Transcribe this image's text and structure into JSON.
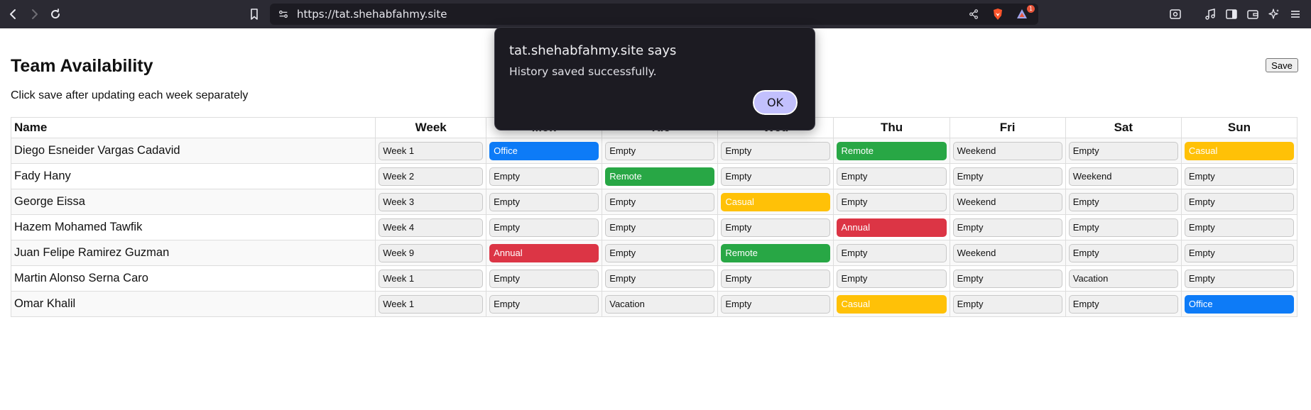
{
  "browser": {
    "url": "https://tat.shehabfahmy.site",
    "notification_count": "1"
  },
  "page": {
    "title": "Team Availability",
    "subtitle": "Click save after updating each week separately",
    "save_label": "Save"
  },
  "table": {
    "headers": [
      "Name",
      "Week",
      "Mon",
      "Tue",
      "Wed",
      "Thu",
      "Fri",
      "Sat",
      "Sun"
    ],
    "rows": [
      {
        "name": "Diego Esneider Vargas Cadavid",
        "week": "Week 1",
        "days": [
          "Office",
          "Empty",
          "Empty",
          "Remote",
          "Weekend",
          "Empty",
          "Casual"
        ]
      },
      {
        "name": "Fady Hany",
        "week": "Week 2",
        "days": [
          "Empty",
          "Remote",
          "Empty",
          "Empty",
          "Empty",
          "Weekend",
          "Empty"
        ]
      },
      {
        "name": "George Eissa",
        "week": "Week 3",
        "days": [
          "Empty",
          "Empty",
          "Casual",
          "Empty",
          "Weekend",
          "Empty",
          "Empty"
        ]
      },
      {
        "name": "Hazem Mohamed Tawfik",
        "week": "Week 4",
        "days": [
          "Empty",
          "Empty",
          "Empty",
          "Annual",
          "Empty",
          "Empty",
          "Empty"
        ]
      },
      {
        "name": "Juan Felipe Ramirez Guzman",
        "week": "Week 9",
        "days": [
          "Annual",
          "Empty",
          "Remote",
          "Empty",
          "Weekend",
          "Empty",
          "Empty"
        ]
      },
      {
        "name": "Martin Alonso Serna Caro",
        "week": "Week 1",
        "days": [
          "Empty",
          "Empty",
          "Empty",
          "Empty",
          "Empty",
          "Vacation",
          "Empty"
        ]
      },
      {
        "name": "Omar Khalil",
        "week": "Week 1",
        "days": [
          "Empty",
          "Vacation",
          "Empty",
          "Casual",
          "Empty",
          "Empty",
          "Office"
        ]
      }
    ]
  },
  "status_colors": {
    "Office": "#0d7bf7",
    "Remote": "#28a745",
    "Casual": "#ffc107",
    "Annual": "#dc3545"
  },
  "alert": {
    "title": "tat.shehabfahmy.site says",
    "message": "History saved successfully.",
    "ok_label": "OK"
  },
  "icons": {
    "toolbar_left": [
      "back-icon",
      "forward-icon",
      "reload-icon"
    ],
    "toolbar_right": [
      "screenshot-icon",
      "media-icon",
      "sidebar-icon",
      "wallet-icon",
      "leo-ai-icon",
      "menu-icon"
    ]
  }
}
